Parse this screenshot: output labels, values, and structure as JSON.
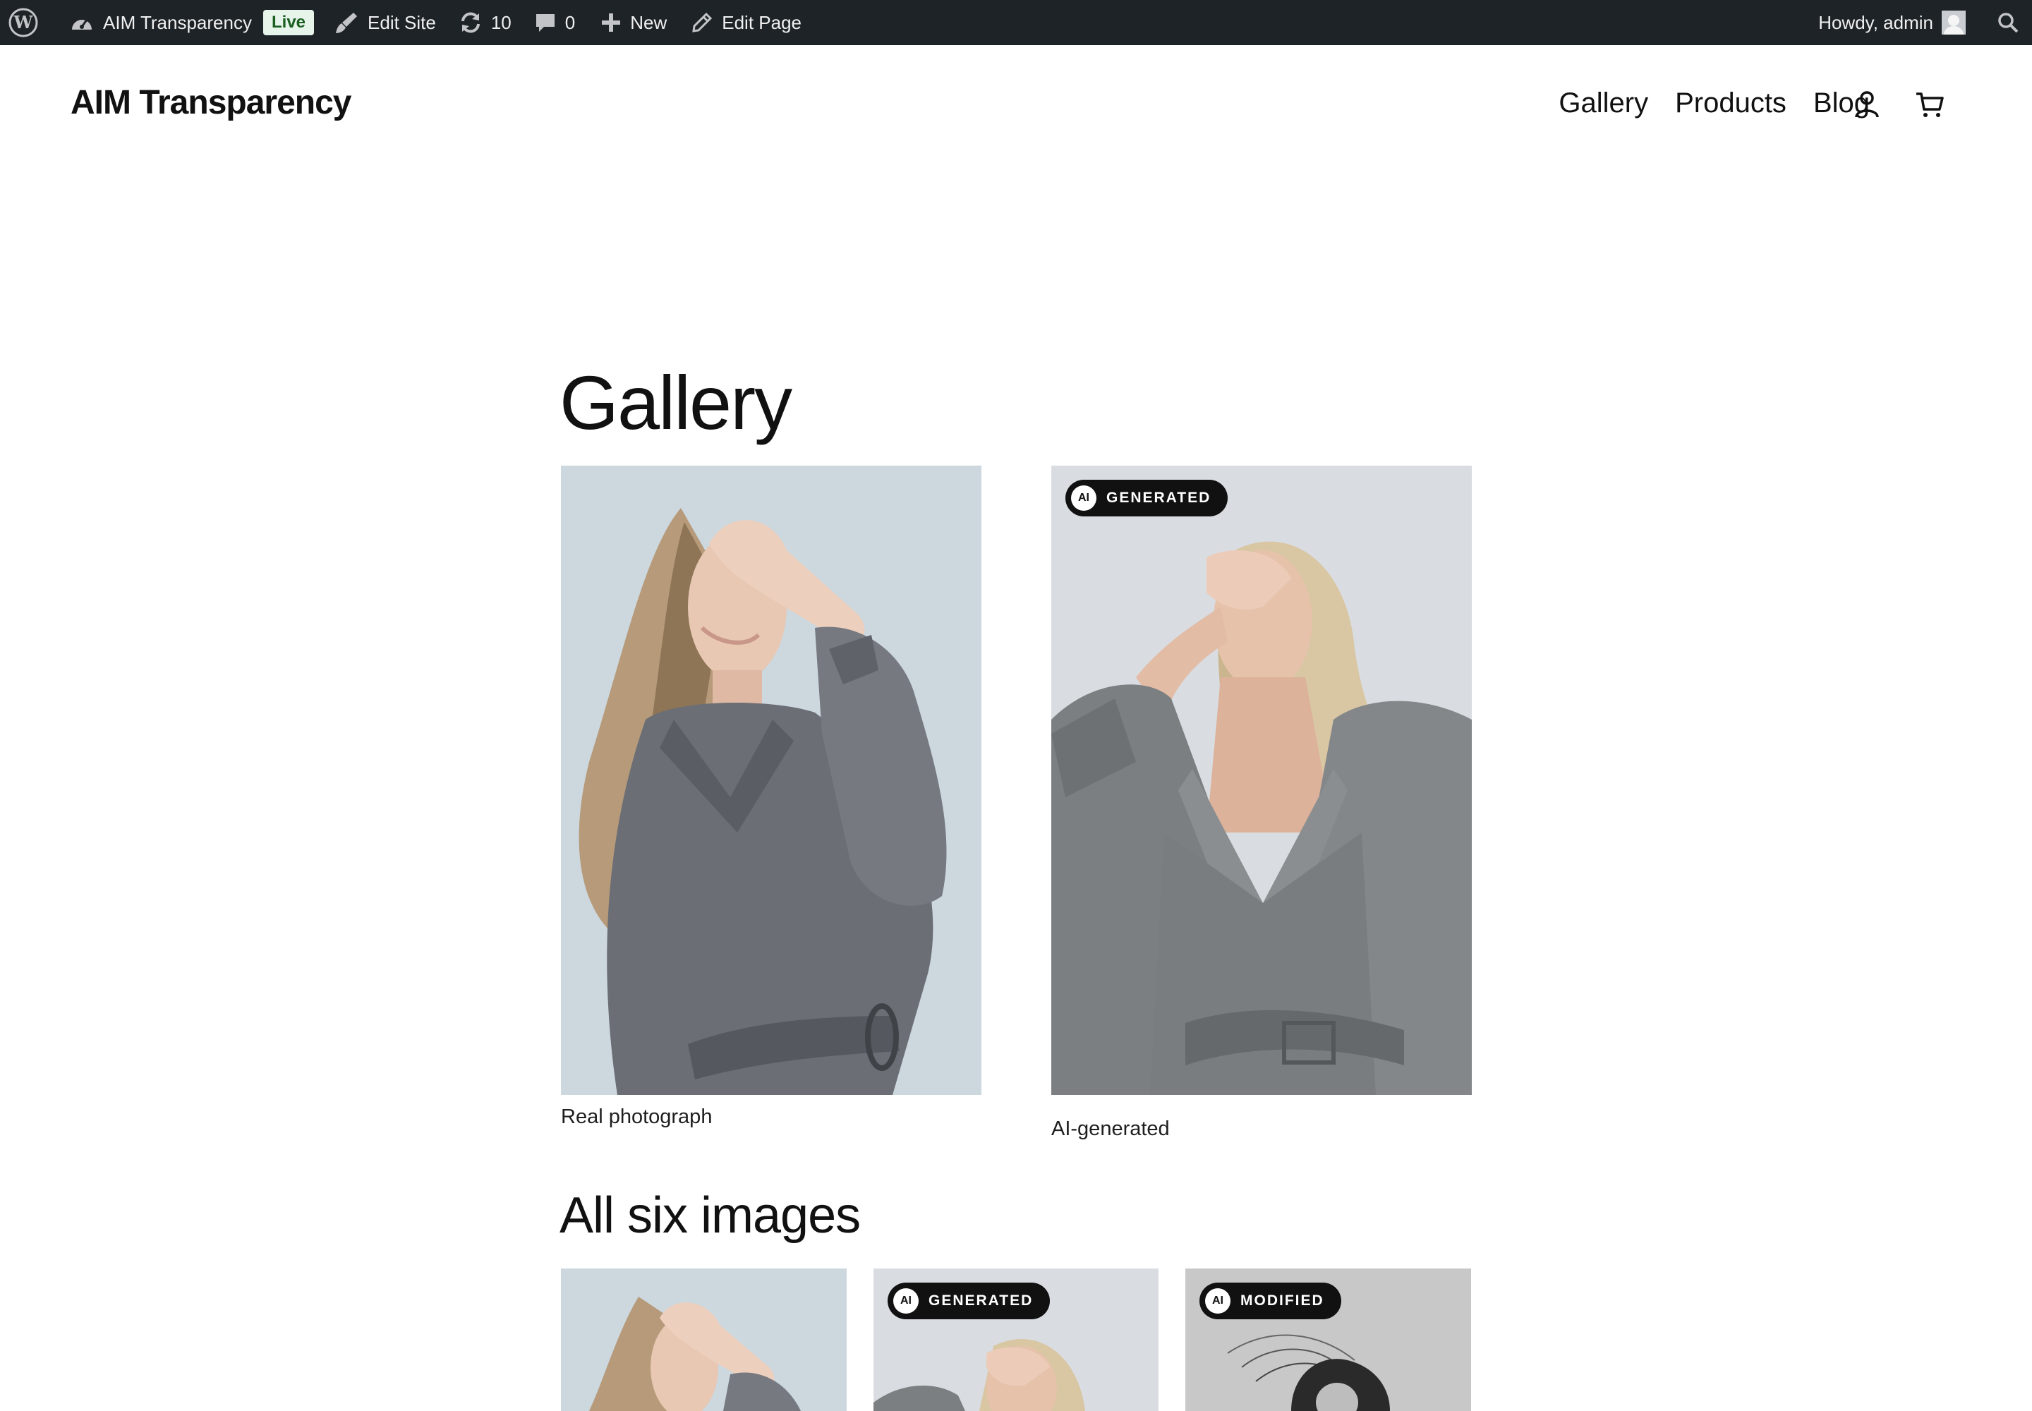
{
  "admin_bar": {
    "site_name": "AIM Transparency",
    "live_label": "Live",
    "edit_site_label": "Edit Site",
    "updates_count": "10",
    "comments_count": "0",
    "new_label": "New",
    "edit_page_label": "Edit Page",
    "greeting": "Howdy, admin"
  },
  "header": {
    "site_title": "AIM Transparency",
    "nav": [
      "Gallery",
      "Products",
      "Blog"
    ]
  },
  "page": {
    "title": "Gallery",
    "featured": [
      {
        "caption": "Real photograph",
        "badge": null
      },
      {
        "caption": "AI-generated",
        "badge": {
          "mark": "AI",
          "label": "GENERATED"
        }
      }
    ],
    "section_title": "All six images",
    "grid": [
      {
        "badge": null
      },
      {
        "badge": {
          "mark": "AI",
          "label": "GENERATED"
        }
      },
      {
        "badge": {
          "mark": "AI",
          "label": "MODIFIED"
        }
      }
    ]
  },
  "colors": {
    "admin_bar_bg": "#1d2327",
    "live_badge_bg": "#e6f4ea",
    "badge_bg": "#111111"
  },
  "icons": [
    "wordpress-icon",
    "dashboard-icon",
    "brush-icon",
    "updates-icon",
    "comment-icon",
    "plus-icon",
    "pencil-icon",
    "search-icon",
    "account-icon",
    "cart-icon"
  ]
}
